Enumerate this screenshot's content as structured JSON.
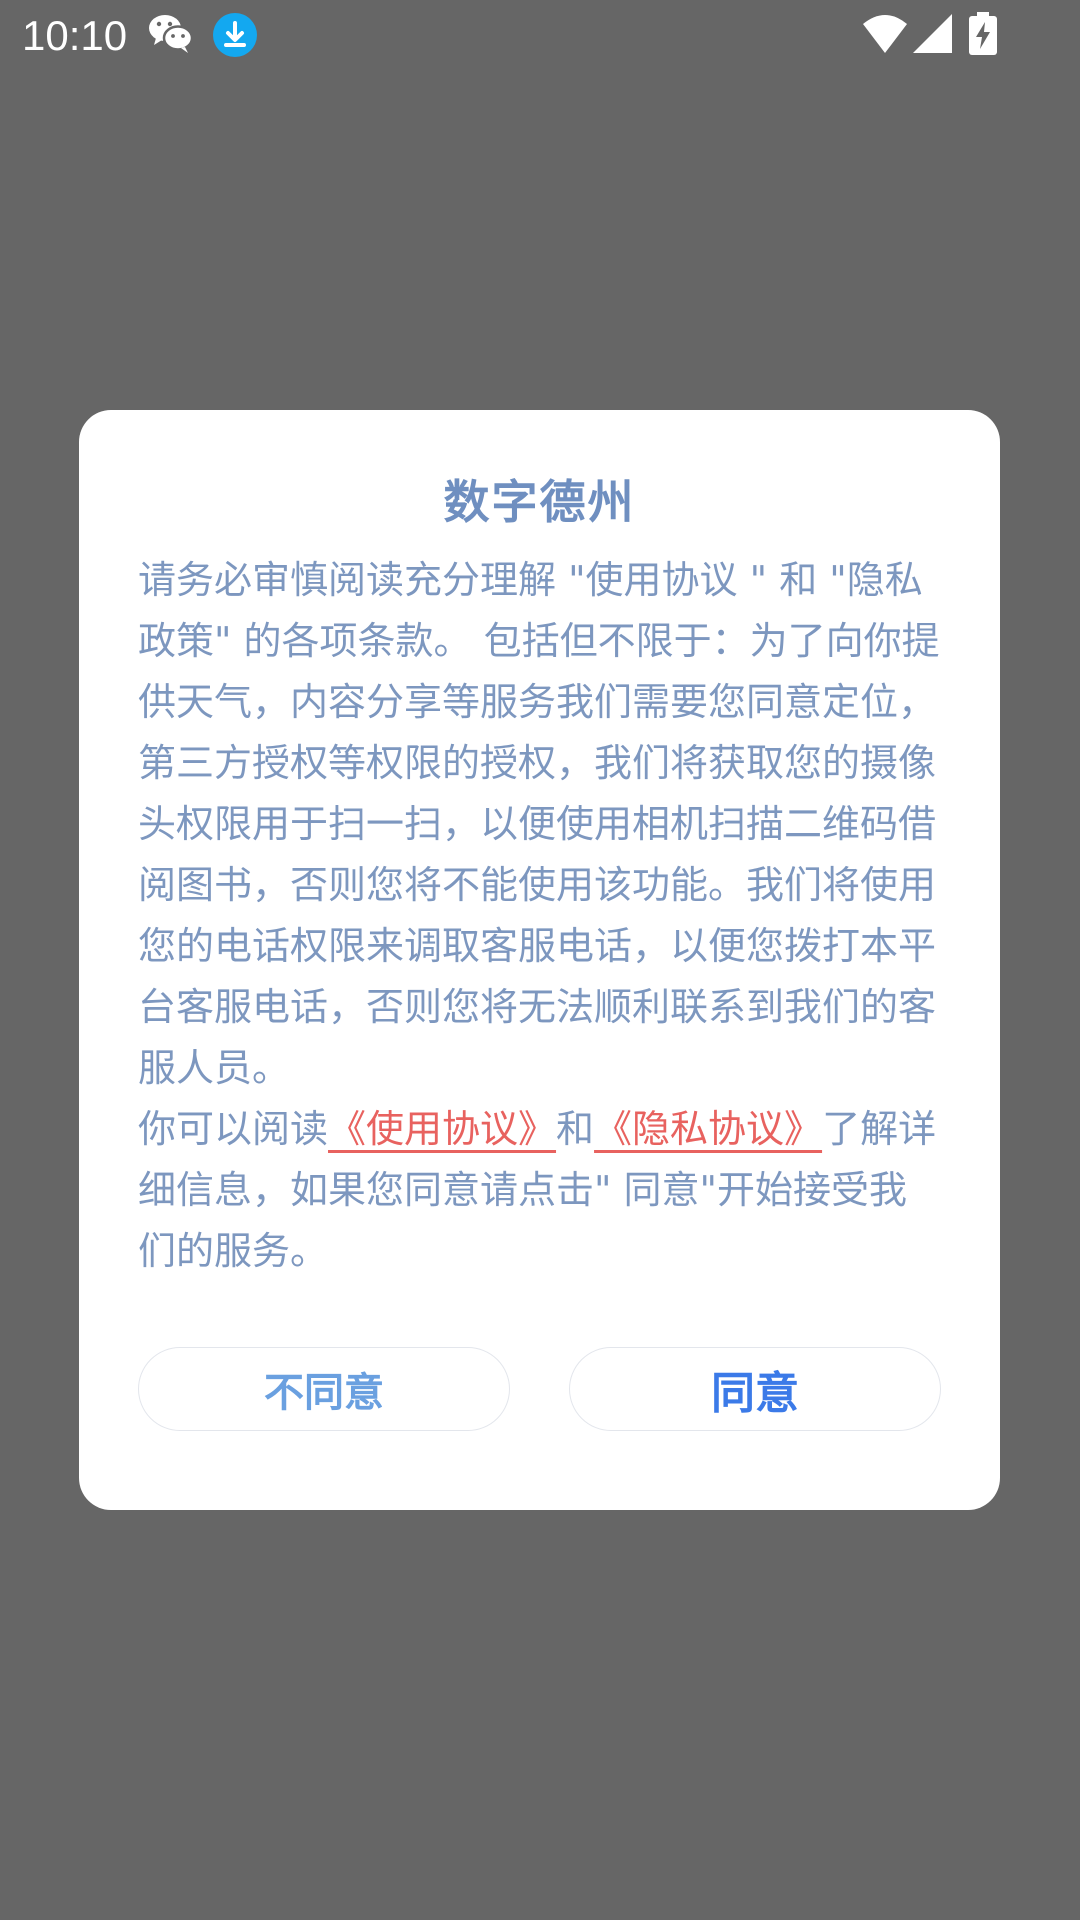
{
  "status_bar": {
    "time": "10:10",
    "icons": [
      "wechat-icon",
      "download-icon",
      "wifi-icon",
      "signal-icon",
      "battery-charging-icon"
    ],
    "download_color": "#13a8f0"
  },
  "dialog": {
    "title": "数字德州",
    "paragraph_1": "请务必审慎阅读充分理解 \"使用协议 \" 和 \"隐私政策\" 的各项条款。 包括但不限于：为了向你提供天气，内容分享等服务我们需要您同意定位，第三方授权等权限的授权，我们将获取您的摄像头权限用于扫一扫，以便使用相机扫描二维码借阅图书，否则您将不能使用该功能。我们将使用您的电话权限来调取客服电话，以便您拨打本平台客服电话，否则您将无法顺利联系到我们的客服人员。",
    "paragraph_2_prefix": "你可以阅读",
    "link_terms": "《使用协议》",
    "connector": "和",
    "link_privacy": "《隐私协议》",
    "paragraph_2_suffix": "了解详细信息，如果您同意请点击\" 同意\"开始接受我们的服务。",
    "disagree_label": "不同意",
    "agree_label": "同意"
  },
  "colors": {
    "overlay": "#666666",
    "title": "#6f8fc0",
    "body_text": "#7d97bf",
    "link": "#e8625f",
    "agree": "#3b7ae8",
    "disagree": "#6aa0e0"
  }
}
